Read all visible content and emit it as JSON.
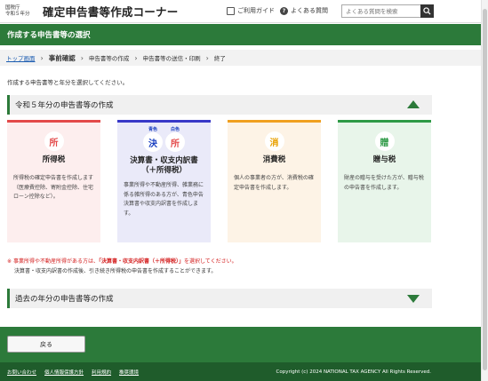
{
  "header": {
    "agency_line1": "国税庁",
    "agency_line2": "令和５年分",
    "site_title": "確定申告書等作成コーナー",
    "guide_label": "ご利用ガイド",
    "faq_label": "よくある質問",
    "search_placeholder": "よくある質問を検索"
  },
  "titlebar": "作成する申告書等の選択",
  "breadcrumb": {
    "top": "トップ画面",
    "current": "事前確認",
    "step3": "申告書等の作成",
    "step4": "申告書等の送信・印刷",
    "step5": "終了"
  },
  "instruction": "作成する申告書等と年分を選択してください。",
  "section_current": "令和５年分の申告書等の作成",
  "cards": [
    {
      "icon": "所",
      "title": "所得税",
      "desc": "所得税の確定申告書を作成します（医療費控除、寄附金控除、住宅ローン控除など）。"
    },
    {
      "icon_tag1": "青色",
      "icon_tag2": "白色",
      "icon1": "決",
      "icon2": "所",
      "title": "決算書・収支内訳書\n（＋所得税）",
      "desc": "事業所得や不動産所得、雑業務に係る雑所得のある方が、青色申告決算書や収支内訳書を作成します。"
    },
    {
      "icon": "消",
      "title": "消費税",
      "desc": "個人の事業者の方が、消費税の確定申告書を作成します。"
    },
    {
      "icon": "贈",
      "title": "贈与税",
      "desc": "財産の贈与を受けた方が、贈与税の申告書を作成します。"
    }
  ],
  "note": {
    "mark": "※",
    "line1_pre": "事業所得や不動産所得がある方は、",
    "line1_emph": "「決算書・収支内訳書（＋所得税）」",
    "line1_post": "を選択してください。",
    "line2": "決算書・収支内訳書の作成後、引き続き所得税の申告書を作成することができます。"
  },
  "section_past": "過去の年分の申告書等の作成",
  "back_label": "戻る",
  "footer": {
    "links": [
      "お問い合わせ",
      "個人情報保護方針",
      "利用規約",
      "推奨環境"
    ],
    "copyright": "Copyright (c) 2024 NATIONAL TAX AGENCY All Rights Reserved."
  },
  "colors": {
    "brand_green": "#2c7a3a",
    "income": "#e34a4a",
    "settlement": "#3838c8",
    "consumption": "#f0a020",
    "gift": "#2e9a46"
  }
}
